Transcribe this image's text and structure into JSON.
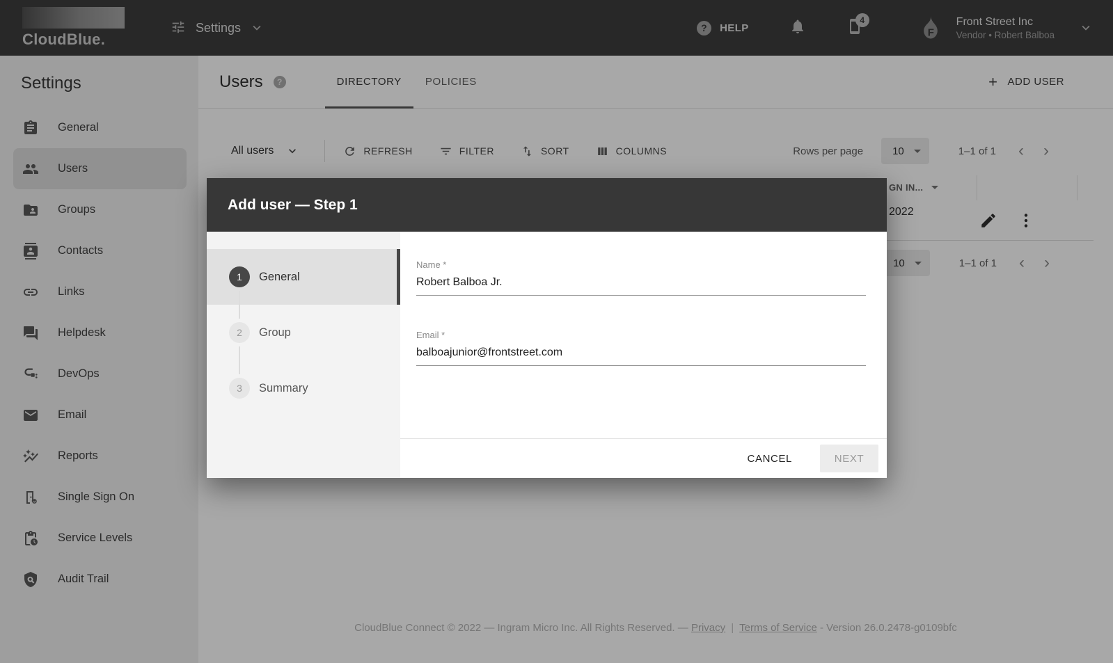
{
  "topbar": {
    "logo_text": "CloudBlue.",
    "nav_label": "Settings",
    "help_label": "HELP",
    "notification_badge": "4",
    "icons": [
      "tune-icon",
      "chevron-down-icon",
      "help-icon",
      "bell-icon",
      "device-notifications-icon"
    ],
    "account": {
      "name": "Front Street Inc",
      "subtitle": "Vendor • Robert Balboa",
      "logo_icon": "flame-f-icon"
    }
  },
  "sidebar": {
    "title": "Settings",
    "items": [
      {
        "label": "General",
        "icon": "clipboard-icon",
        "active": false
      },
      {
        "label": "Users",
        "icon": "people-icon",
        "active": true
      },
      {
        "label": "Groups",
        "icon": "folder-person-icon",
        "active": false
      },
      {
        "label": "Contacts",
        "icon": "contact-card-icon",
        "active": false
      },
      {
        "label": "Links",
        "icon": "link-icon",
        "active": false
      },
      {
        "label": "Helpdesk",
        "icon": "chat-bubbles-icon",
        "active": false
      },
      {
        "label": "DevOps",
        "icon": "pipeline-plug-icon",
        "active": false
      },
      {
        "label": "Email",
        "icon": "envelope-icon",
        "active": false
      },
      {
        "label": "Reports",
        "icon": "sparkle-graph-icon",
        "active": false
      },
      {
        "label": "Single Sign On",
        "icon": "door-gear-icon",
        "active": false
      },
      {
        "label": "Service Levels",
        "icon": "clipboard-clock-icon",
        "active": false
      },
      {
        "label": "Audit Trail",
        "icon": "shield-search-icon",
        "active": false
      }
    ]
  },
  "page": {
    "title": "Users",
    "tabs": [
      {
        "label": "DIRECTORY",
        "active": true
      },
      {
        "label": "POLICIES",
        "active": false
      }
    ],
    "add_user_label": "ADD USER",
    "plus_glyph": "+"
  },
  "toolbar": {
    "scope_label": "All users",
    "refresh_label": "REFRESH",
    "filter_label": "FILTER",
    "sort_label": "SORT",
    "columns_label": "COLUMNS",
    "rows_per_page_label": "Rows per page",
    "rows_per_page_value": "10",
    "range_label": "1–1 of 1",
    "prev_glyph": "‹",
    "next_glyph": "›"
  },
  "table": {
    "visible_column_header": "GN IN...",
    "visible_cell_value": "2022",
    "row_icons": [
      "edit-pencil-icon",
      "more-vert-icon"
    ],
    "bottom_rows_per_page_value": "10",
    "bottom_range_label": "1–1 of 1",
    "prev_glyph": "‹",
    "next_glyph": "›"
  },
  "modal": {
    "title": "Add user — Step 1",
    "steps": [
      {
        "number": "1",
        "label": "General",
        "active": true
      },
      {
        "number": "2",
        "label": "Group",
        "active": false
      },
      {
        "number": "3",
        "label": "Summary",
        "active": false
      }
    ],
    "fields": [
      {
        "label": "Name *",
        "value": "Robert Balboa Jr."
      },
      {
        "label": "Email *",
        "value": "balboajunior@frontstreet.com"
      }
    ],
    "cancel_label": "CANCEL",
    "next_label": "NEXT"
  },
  "footer": {
    "text_before": "CloudBlue Connect © 2022 — Ingram Micro Inc. All Rights Reserved. —",
    "privacy_label": "Privacy",
    "separator": "|",
    "terms_label": "Terms of Service",
    "text_after": "- Version 26.0.2478-g0109bfc"
  },
  "colors": {
    "topbar_bg": "#3d3d3d",
    "sidebar_bg": "#f0f0f0",
    "sidebar_active_bg": "#dcdcdc",
    "modal_header_bg": "#373737",
    "step_active_indicator": "#474747",
    "overlay": "rgba(0,0,0,0.34)",
    "next_button_bg": "#ececec"
  },
  "help_glyph": "?"
}
